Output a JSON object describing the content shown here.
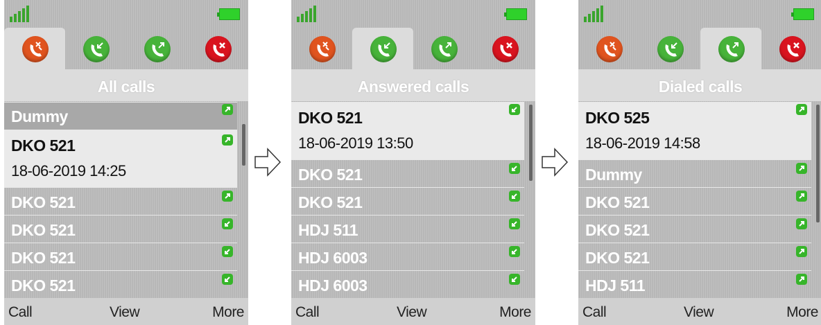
{
  "softkeys": {
    "left": "Call",
    "center": "View",
    "right": "More"
  },
  "tabs": [
    "missed-calls-icon",
    "answered-calls-icon",
    "dialed-calls-icon",
    "rejected-calls-icon"
  ],
  "colors": {
    "missed": "#e0541f",
    "answered": "#47b33a",
    "dialed": "#47b33a",
    "rejected": "#d9141f",
    "battery": "#2fd12b",
    "signal": "#3aa52d"
  },
  "screens": [
    {
      "title": "All calls",
      "active_tab": 0,
      "rows": [
        {
          "name": "Dummy",
          "type": "dialed",
          "state": "dim"
        },
        {
          "name": "DKO 521",
          "date": "18-06-2019 14:25",
          "type": "dialed",
          "state": "selected"
        },
        {
          "name": "DKO 521",
          "type": "dialed"
        },
        {
          "name": "DKO 521",
          "type": "answered"
        },
        {
          "name": "DKO 521",
          "type": "answered"
        },
        {
          "name": "DKO 521",
          "type": "answered"
        }
      ]
    },
    {
      "title": "Answered calls",
      "active_tab": 1,
      "rows": [
        {
          "name": "DKO 521",
          "date": "18-06-2019 13:50",
          "type": "answered",
          "state": "selected"
        },
        {
          "name": "DKO 521",
          "type": "answered"
        },
        {
          "name": "DKO 521",
          "type": "answered"
        },
        {
          "name": "HDJ 511",
          "type": "answered"
        },
        {
          "name": "HDJ 6003",
          "type": "answered"
        },
        {
          "name": "HDJ 6003",
          "type": "answered"
        }
      ]
    },
    {
      "title": "Dialed calls",
      "active_tab": 2,
      "rows": [
        {
          "name": "DKO 525",
          "date": "18-06-2019 14:58",
          "type": "dialed",
          "state": "selected"
        },
        {
          "name": "Dummy",
          "type": "dialed"
        },
        {
          "name": "DKO 521",
          "type": "dialed"
        },
        {
          "name": "DKO 521",
          "type": "dialed"
        },
        {
          "name": "DKO 521",
          "type": "dialed"
        },
        {
          "name": "HDJ 511",
          "type": "dialed"
        }
      ]
    }
  ]
}
